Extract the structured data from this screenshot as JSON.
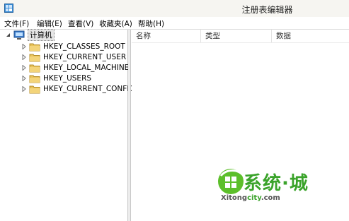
{
  "window": {
    "title": "注册表编辑器"
  },
  "menu": {
    "items": [
      "文件(F)",
      "编辑(E)",
      "查看(V)",
      "收藏夹(A)",
      "帮助(H)"
    ]
  },
  "tree": {
    "root": {
      "label": "计算机",
      "icon": "computer-icon",
      "expanded": true
    },
    "keys": [
      {
        "label": "HKEY_CLASSES_ROOT",
        "icon": "folder-icon"
      },
      {
        "label": "HKEY_CURRENT_USER",
        "icon": "folder-icon"
      },
      {
        "label": "HKEY_LOCAL_MACHINE",
        "icon": "folder-icon"
      },
      {
        "label": "HKEY_USERS",
        "icon": "folder-icon"
      },
      {
        "label": "HKEY_CURRENT_CONFIG",
        "icon": "folder-icon"
      }
    ]
  },
  "list": {
    "columns": [
      "名称",
      "类型",
      "数据"
    ],
    "rows": []
  },
  "watermark": {
    "brand": "系统",
    "brand_sep": "·",
    "brand_end": "城",
    "url_main": "Xitong",
    "url_domain": "city",
    "url_tld": ".com"
  },
  "colors": {
    "folder": "#e8c35a",
    "accent": "#3aa32a"
  }
}
